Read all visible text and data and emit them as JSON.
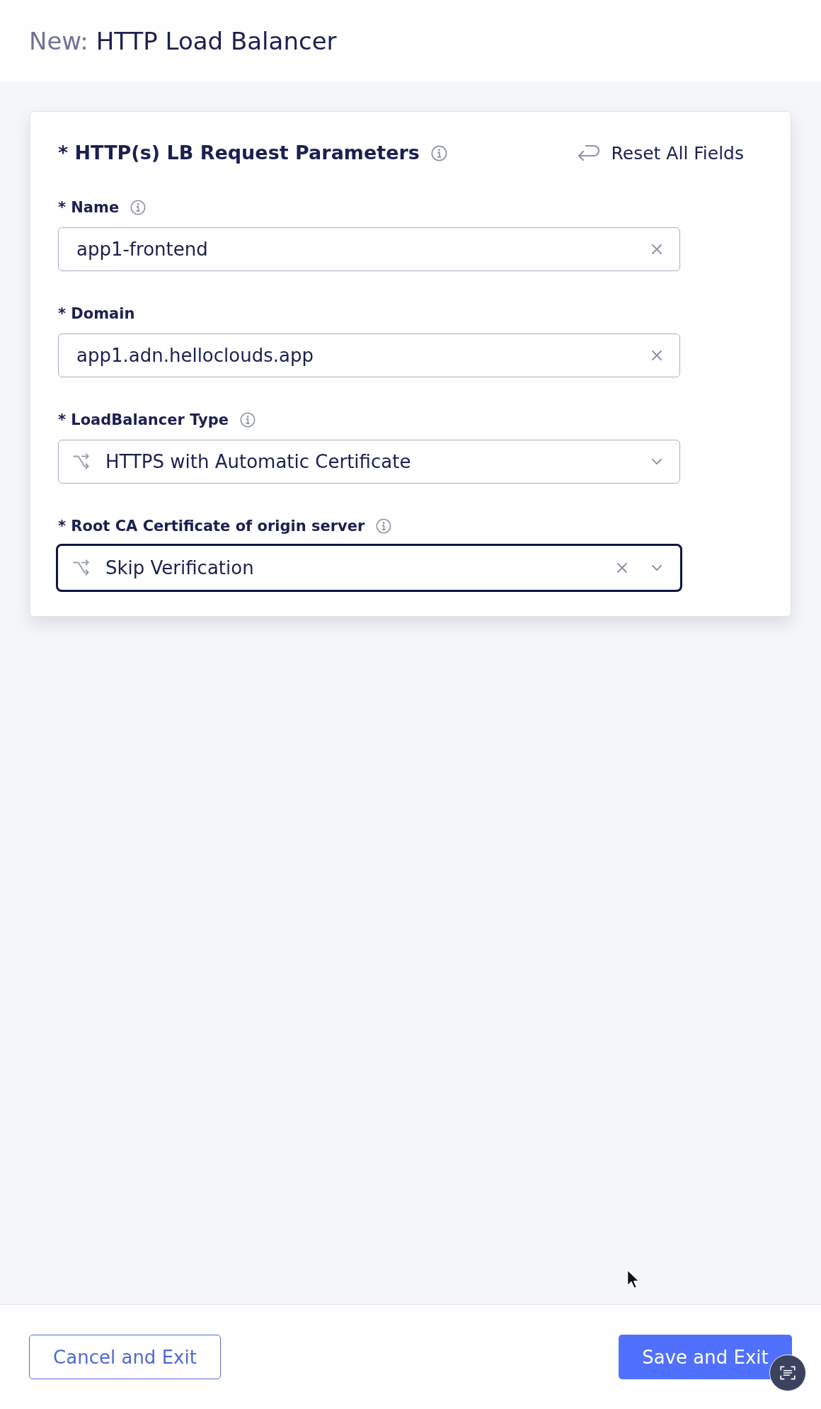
{
  "header": {
    "prefix": "New:",
    "title": "HTTP Load Balancer"
  },
  "card": {
    "title": "* HTTP(s) LB Request Parameters",
    "info": true,
    "reset_label": "Reset All Fields"
  },
  "fields": [
    {
      "kind": "text",
      "label": "* Name",
      "info": true,
      "value": "app1-frontend",
      "clearable": true,
      "focused": false
    },
    {
      "kind": "text",
      "label": "* Domain",
      "info": false,
      "value": "app1.adn.helloclouds.app",
      "clearable": true,
      "focused": false
    },
    {
      "kind": "select",
      "label": "* LoadBalancer Type",
      "info": true,
      "value": "HTTPS with Automatic Certificate",
      "clearable": false,
      "focused": false
    },
    {
      "kind": "select",
      "label": "* Root CA Certificate of origin server",
      "info": true,
      "value": "Skip Verification",
      "clearable": true,
      "focused": true
    }
  ],
  "footer": {
    "buttons": [
      {
        "label": "Cancel and Exit",
        "kind": "secondary"
      },
      {
        "label": "Save and Exit",
        "kind": "primary"
      }
    ]
  }
}
